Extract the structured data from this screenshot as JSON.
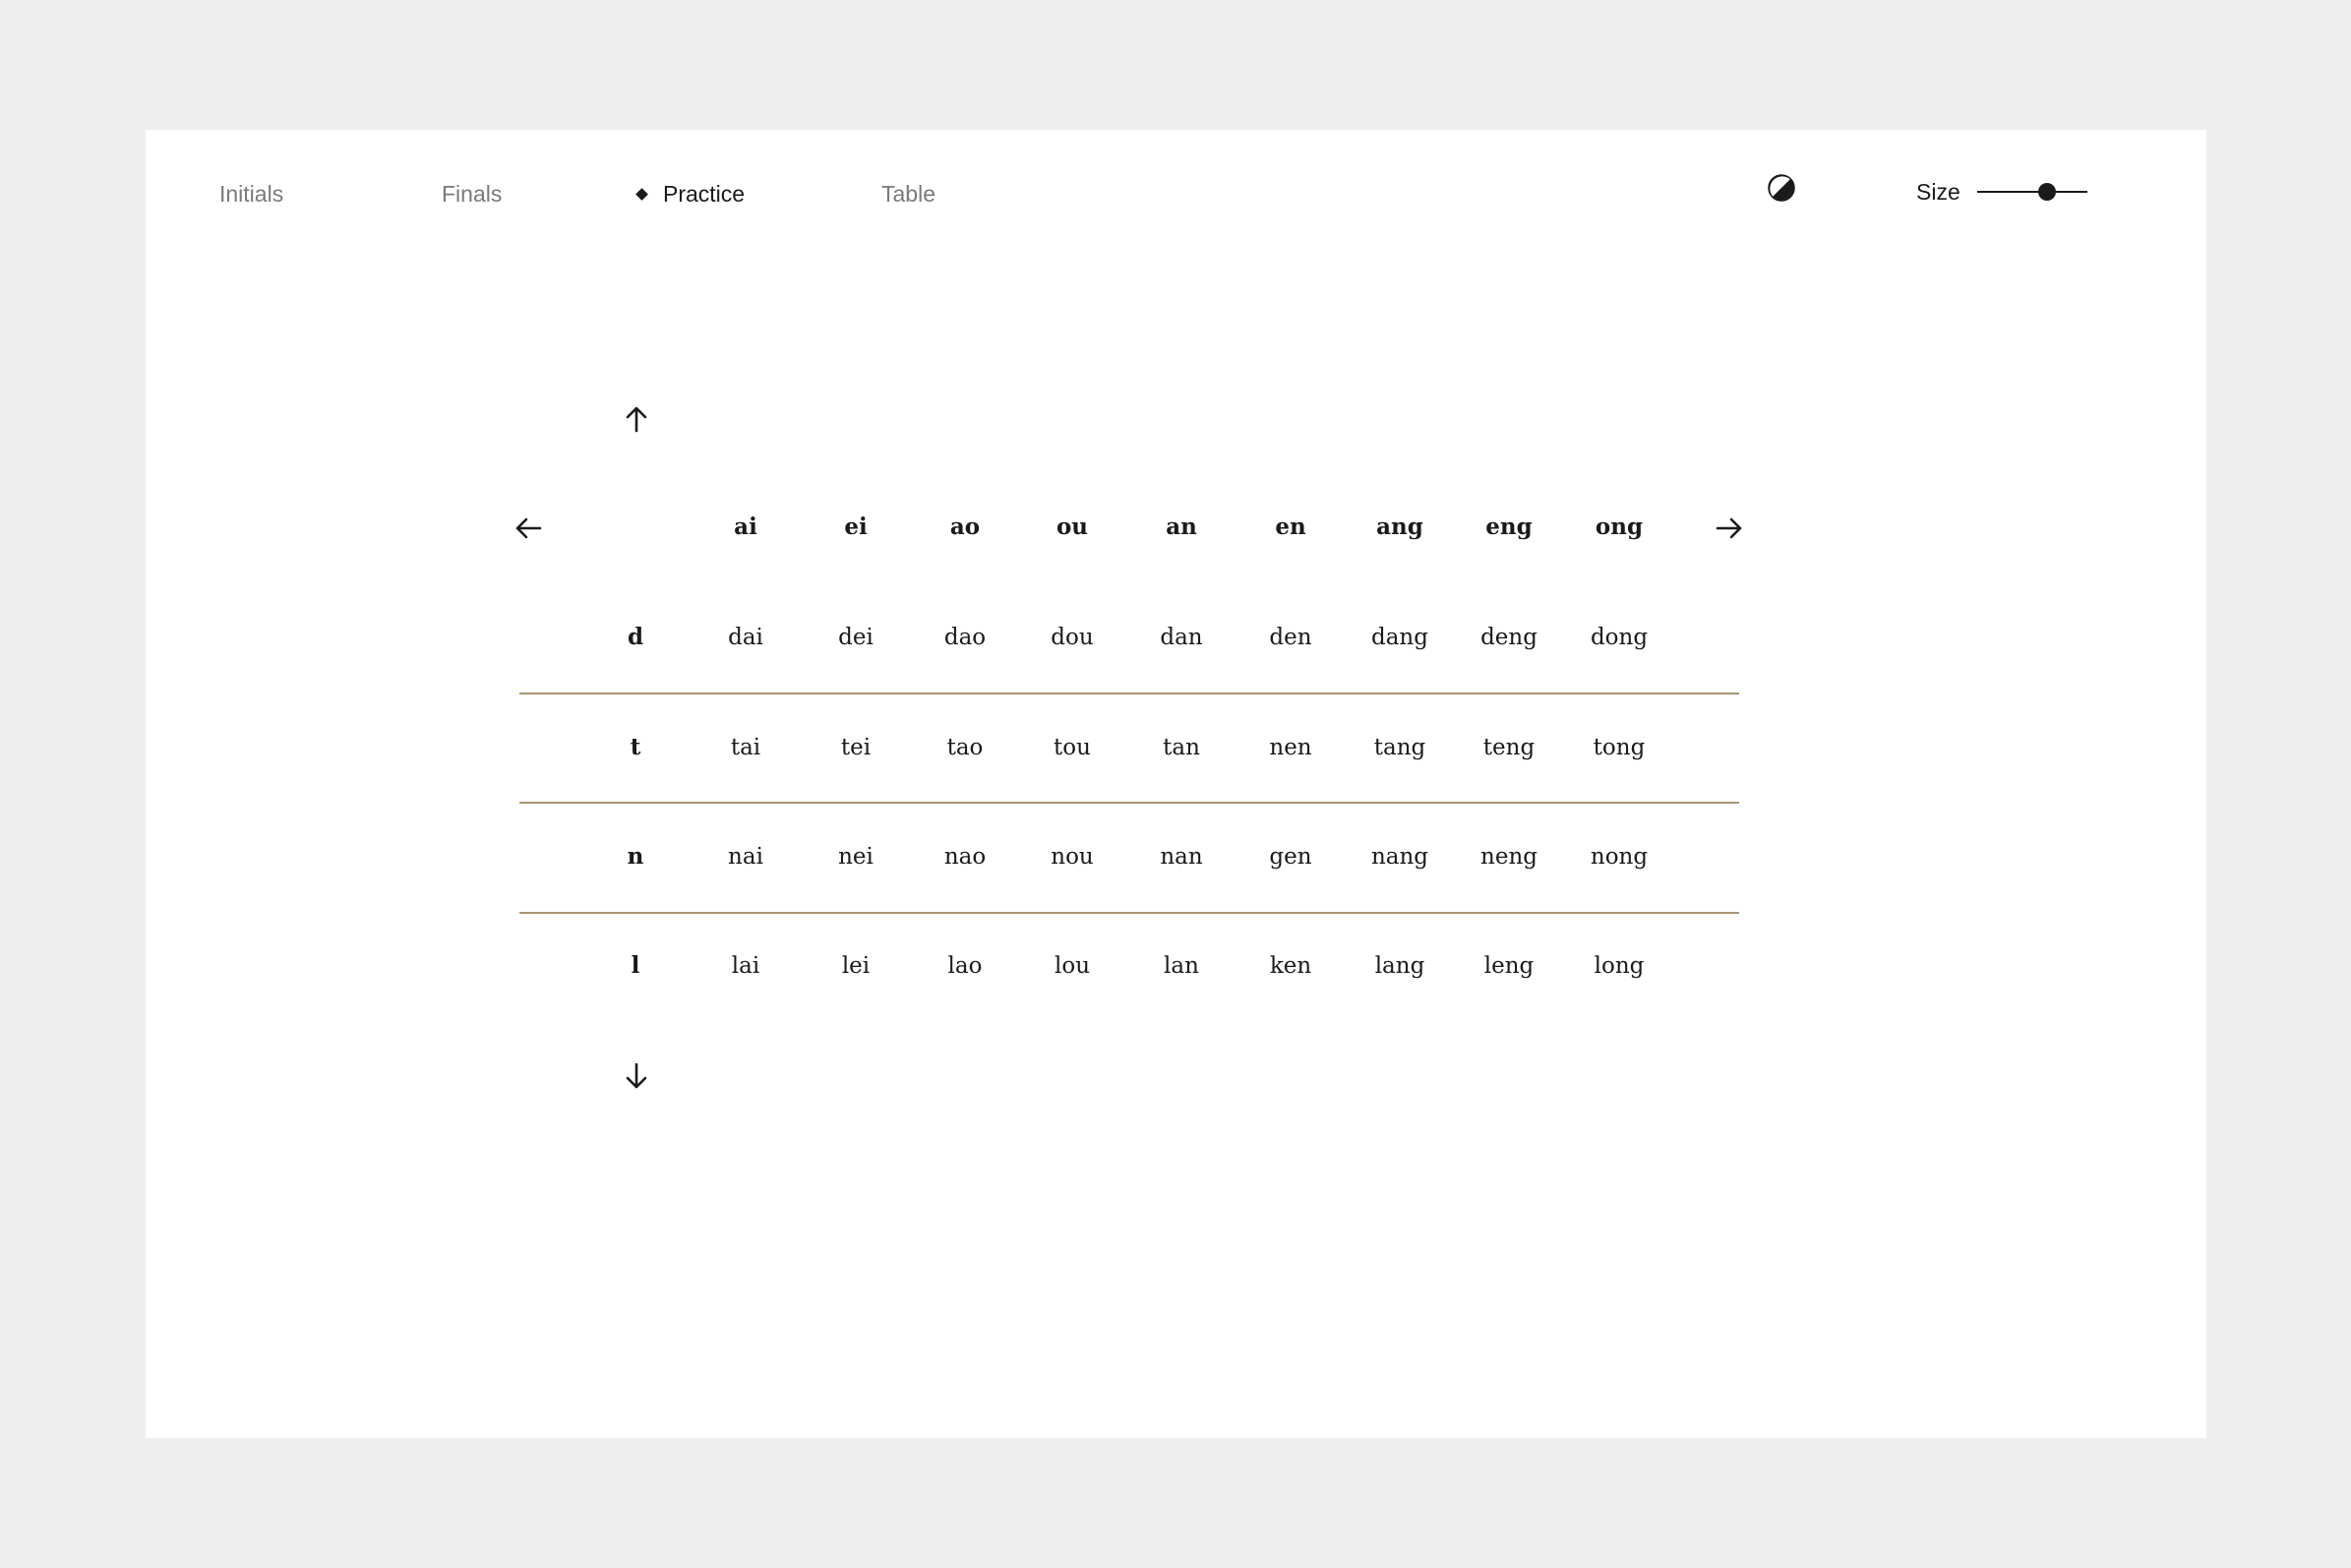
{
  "nav": {
    "items": [
      {
        "label": "Initials",
        "active": false
      },
      {
        "label": "Finals",
        "active": false
      },
      {
        "label": "Practice",
        "active": true
      },
      {
        "label": "Table",
        "active": false
      }
    ]
  },
  "controls": {
    "contrast_icon": "contrast-icon",
    "size_label": "Size",
    "size_value": 0.63
  },
  "colors": {
    "background": "#eeeeee",
    "card": "#ffffff",
    "rule": "#a99675",
    "text": "#1a1a1a",
    "muted": "#7a7a7a"
  },
  "grid": {
    "finals": [
      "ai",
      "ei",
      "ao",
      "ou",
      "an",
      "en",
      "ang",
      "eng",
      "ong"
    ],
    "rows": [
      {
        "initial": "d",
        "syllables": [
          "dai",
          "dei",
          "dao",
          "dou",
          "dan",
          "den",
          "dang",
          "deng",
          "dong"
        ]
      },
      {
        "initial": "t",
        "syllables": [
          "tai",
          "tei",
          "tao",
          "tou",
          "tan",
          "nen",
          "tang",
          "teng",
          "tong"
        ]
      },
      {
        "initial": "n",
        "syllables": [
          "nai",
          "nei",
          "nao",
          "nou",
          "nan",
          "gen",
          "nang",
          "neng",
          "nong"
        ]
      },
      {
        "initial": "l",
        "syllables": [
          "lai",
          "lei",
          "lao",
          "lou",
          "lan",
          "ken",
          "lang",
          "leng",
          "long"
        ]
      }
    ]
  }
}
